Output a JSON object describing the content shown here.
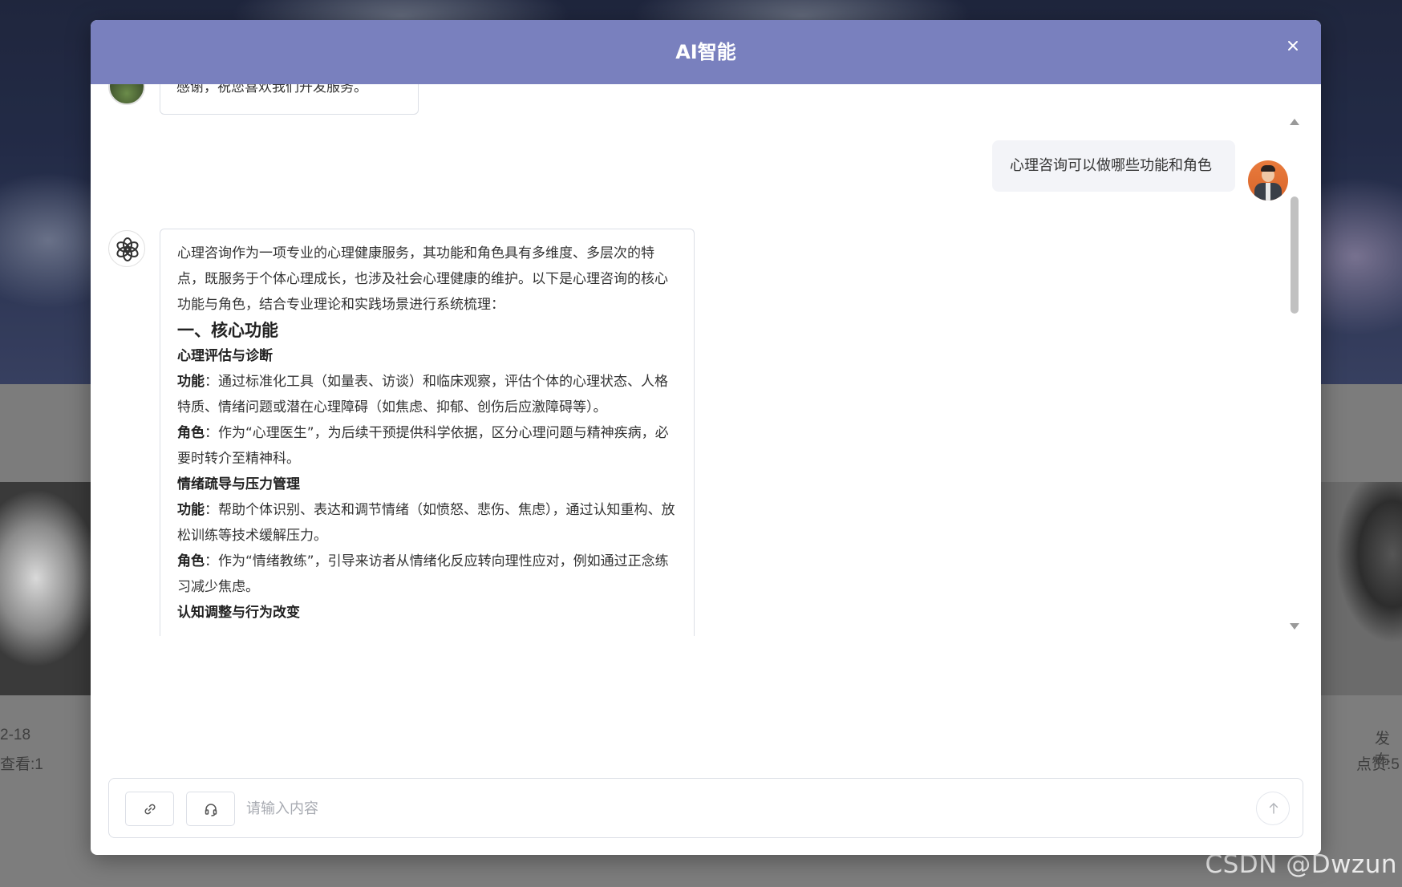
{
  "background": {
    "left_date": "2-18",
    "left_views": "查看:1",
    "right_publish": "发布",
    "right_likes": "点赞:5",
    "watermark": "CSDN @Dwzun"
  },
  "modal": {
    "title": "AI智能",
    "close_icon": "close-icon"
  },
  "chat": {
    "previous_ai_partial": "感谢，祝您喜欢我们开发服务。",
    "user_message": "心理咨询可以做哪些功能和角色",
    "ai_reply": {
      "intro": "心理咨询作为一项专业的心理健康服务，其功能和角色具有多维度、多层次的特点，既服务于个体心理成长，也涉及社会心理健康的维护。以下是心理咨询的核心功能与角色，结合专业理论和实践场景进行系统梳理：",
      "section_title": "一、核心功能",
      "items": [
        {
          "heading": "心理评估与诊断",
          "function_label": "功能",
          "function_text": "：通过标准化工具（如量表、访谈）和临床观察，评估个体的心理状态、人格特质、情绪问题或潜在心理障碍（如焦虑、抑郁、创伤后应激障碍等）。",
          "role_label": "角色",
          "role_text": "：作为“心理医生”，为后续干预提供科学依据，区分心理问题与精神疾病，必要时转介至精神科。"
        },
        {
          "heading": "情绪疏导与压力管理",
          "function_label": "功能",
          "function_text": "：帮助个体识别、表达和调节情绪（如愤怒、悲伤、焦虑），通过认知重构、放松训练等技术缓解压力。",
          "role_label": "角色",
          "role_text": "：作为“情绪教练”，引导来访者从情绪化反应转向理性应对，例如通过正念练习减少焦虑。"
        },
        {
          "heading": "认知调整与行为改变",
          "function_label": "",
          "function_text": "",
          "role_label": "",
          "role_text": ""
        }
      ]
    }
  },
  "input": {
    "placeholder": "请输入内容",
    "value": "",
    "link_icon": "link-icon",
    "headset_icon": "headset-icon",
    "send_icon": "arrow-up-icon"
  },
  "colors": {
    "header": "#7980be",
    "user_bubble": "#f3f4f8",
    "border": "#dcdfe6"
  }
}
